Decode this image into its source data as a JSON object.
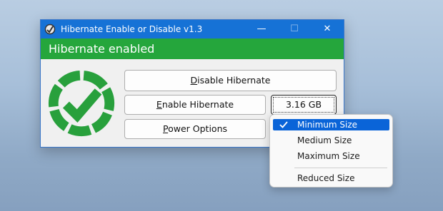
{
  "window": {
    "title": "Hibernate Enable or Disable v1.3",
    "status_text": "Hibernate enabled",
    "controls": {
      "minimize": "—",
      "maximize": "☐",
      "close": "✕"
    }
  },
  "buttons": {
    "disable_prefix": "",
    "disable_hotkey": "D",
    "disable_rest": "isable Hibernate",
    "enable_hotkey": "E",
    "enable_rest": "nable Hibernate",
    "size_label": "3.16 GB",
    "power_hotkey": "P",
    "power_rest": "ower Options"
  },
  "menu": {
    "items": [
      {
        "label": "Minimum Size",
        "checked": true,
        "selected": true
      },
      {
        "label": "Medium Size",
        "checked": false,
        "selected": false
      },
      {
        "label": "Maximum Size",
        "checked": false,
        "selected": false
      },
      {
        "label": "Reduced Size",
        "checked": false,
        "selected": false
      }
    ]
  },
  "colors": {
    "titlebar": "#1672d6",
    "status_bar": "#25a63c",
    "menu_highlight": "#0a64d8",
    "logo_green": "#28a03c"
  },
  "icons": {
    "app_icon": "hibernate-app-icon",
    "status_logo": "check-circle-dashed-icon",
    "menu_check": "checkmark-icon"
  }
}
